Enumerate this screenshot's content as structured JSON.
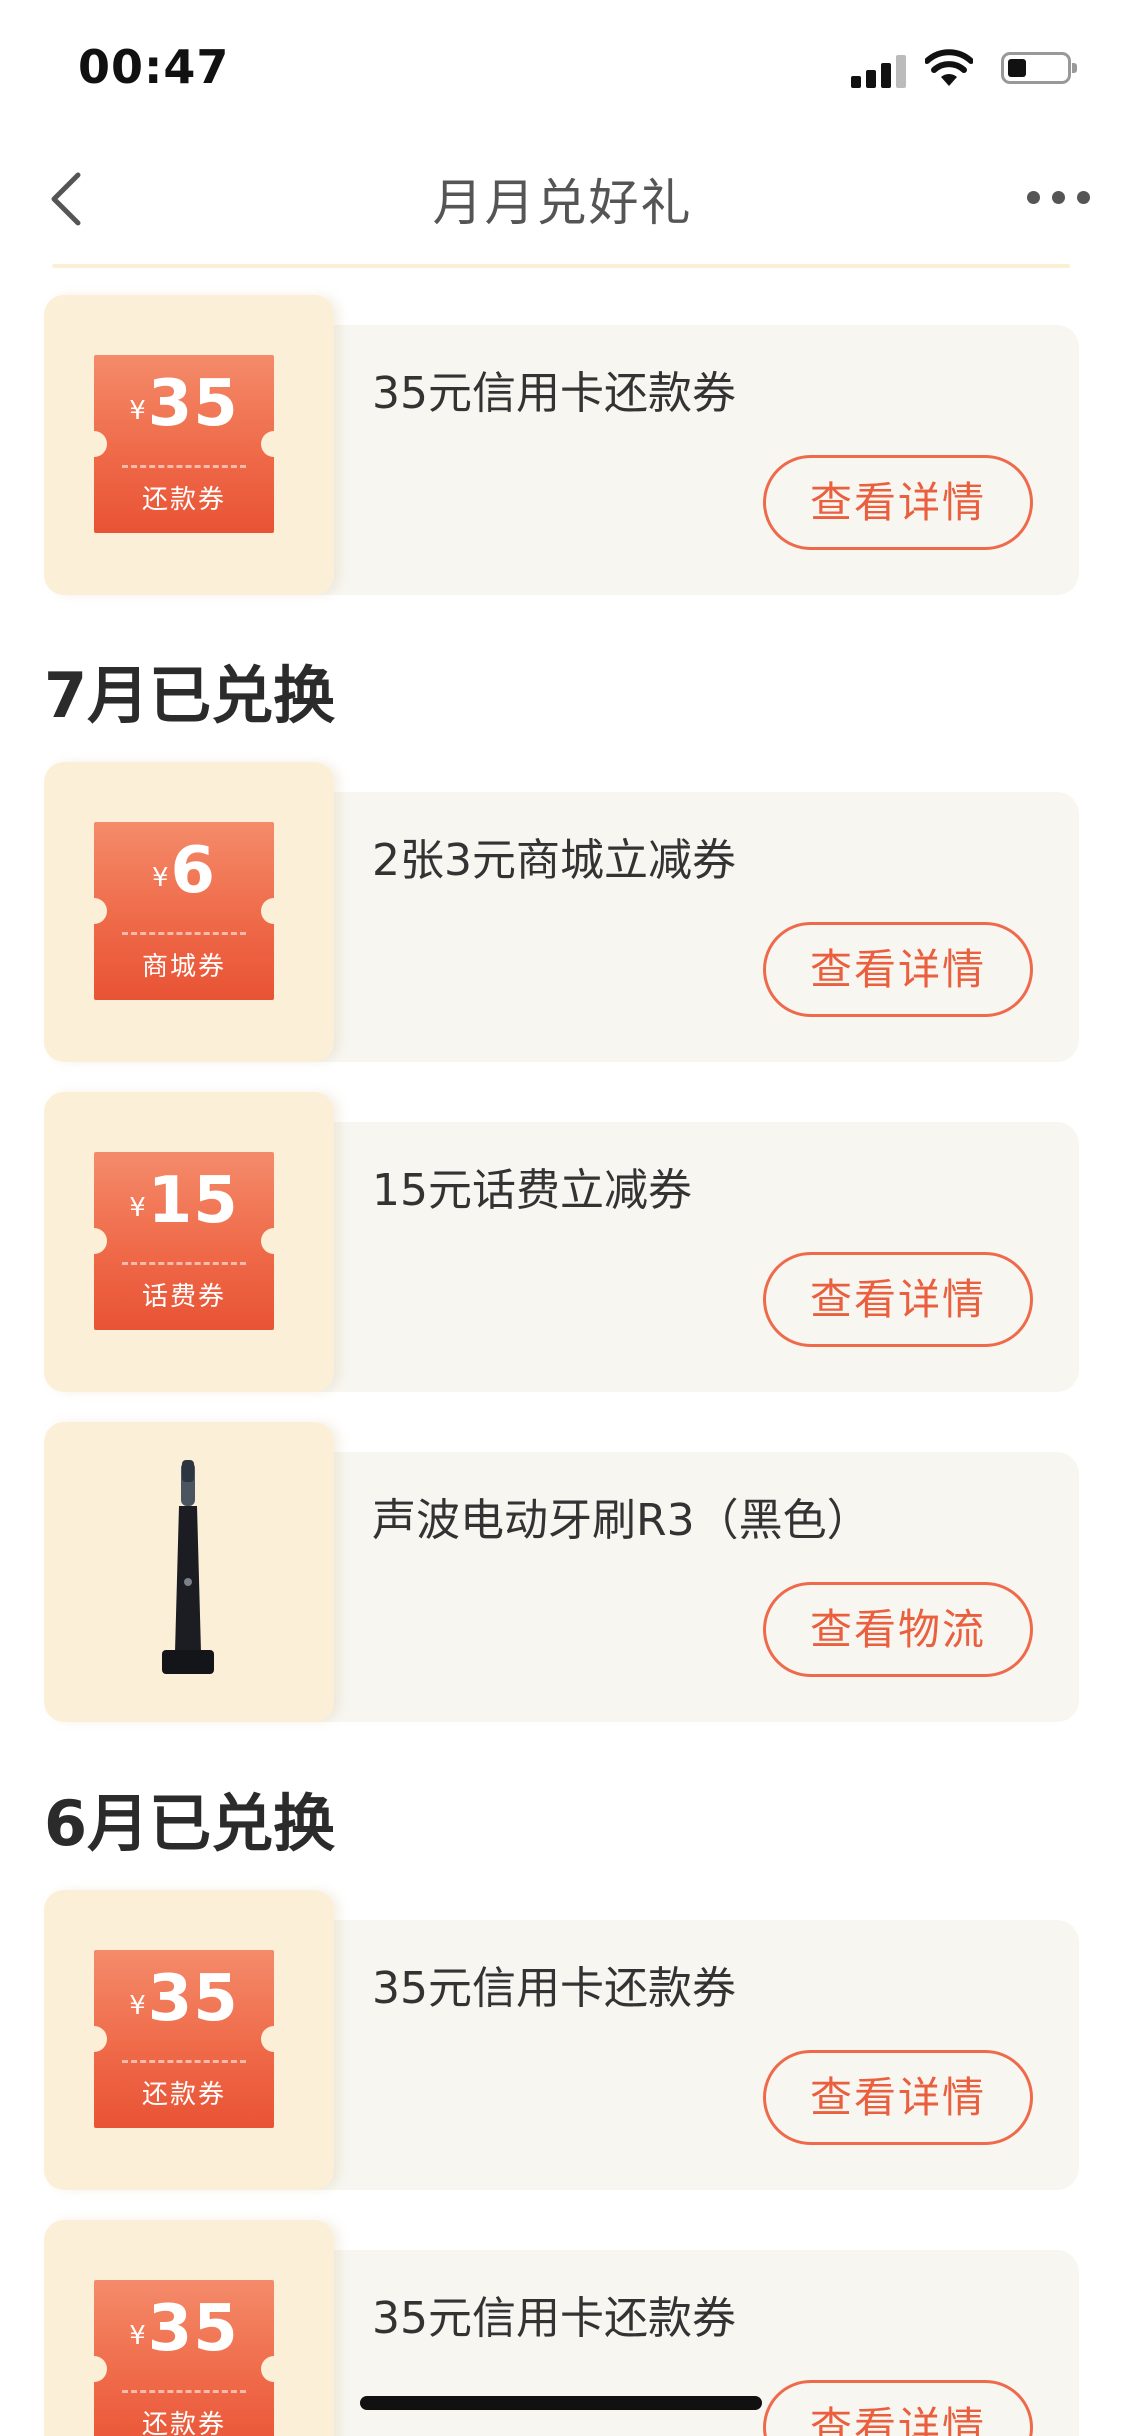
{
  "status_bar": {
    "time": "00:47"
  },
  "nav": {
    "title": "月月兑好礼"
  },
  "sections": {
    "july": {
      "title": "7月已兑换"
    },
    "june": {
      "title": "6月已兑换"
    }
  },
  "items": [
    {
      "name": "35元信用卡还款券",
      "coupon_yen": "¥",
      "coupon_amount": "35",
      "coupon_label": "还款券",
      "button": "查看详情"
    },
    {
      "name": "2张3元商城立减券",
      "coupon_yen": "¥",
      "coupon_amount": "6",
      "coupon_label": "商城券",
      "button": "查看详情"
    },
    {
      "name": "15元话费立减券",
      "coupon_yen": "¥",
      "coupon_amount": "15",
      "coupon_label": "话费券",
      "button": "查看详情"
    },
    {
      "name": "声波电动牙刷R3（黑色）",
      "image": "toothbrush-image",
      "button": "查看物流"
    },
    {
      "name": "35元信用卡还款券",
      "coupon_yen": "¥",
      "coupon_amount": "35",
      "coupon_label": "还款券",
      "button": "查看详情"
    },
    {
      "name": "35元信用卡还款券",
      "coupon_yen": "¥",
      "coupon_amount": "35",
      "coupon_label": "还款券",
      "button": "查看详情"
    }
  ],
  "colors": {
    "accent": "#ea5f3e",
    "card_bg": "#f7f6f1",
    "thumb_bg": "#fcefd7"
  }
}
